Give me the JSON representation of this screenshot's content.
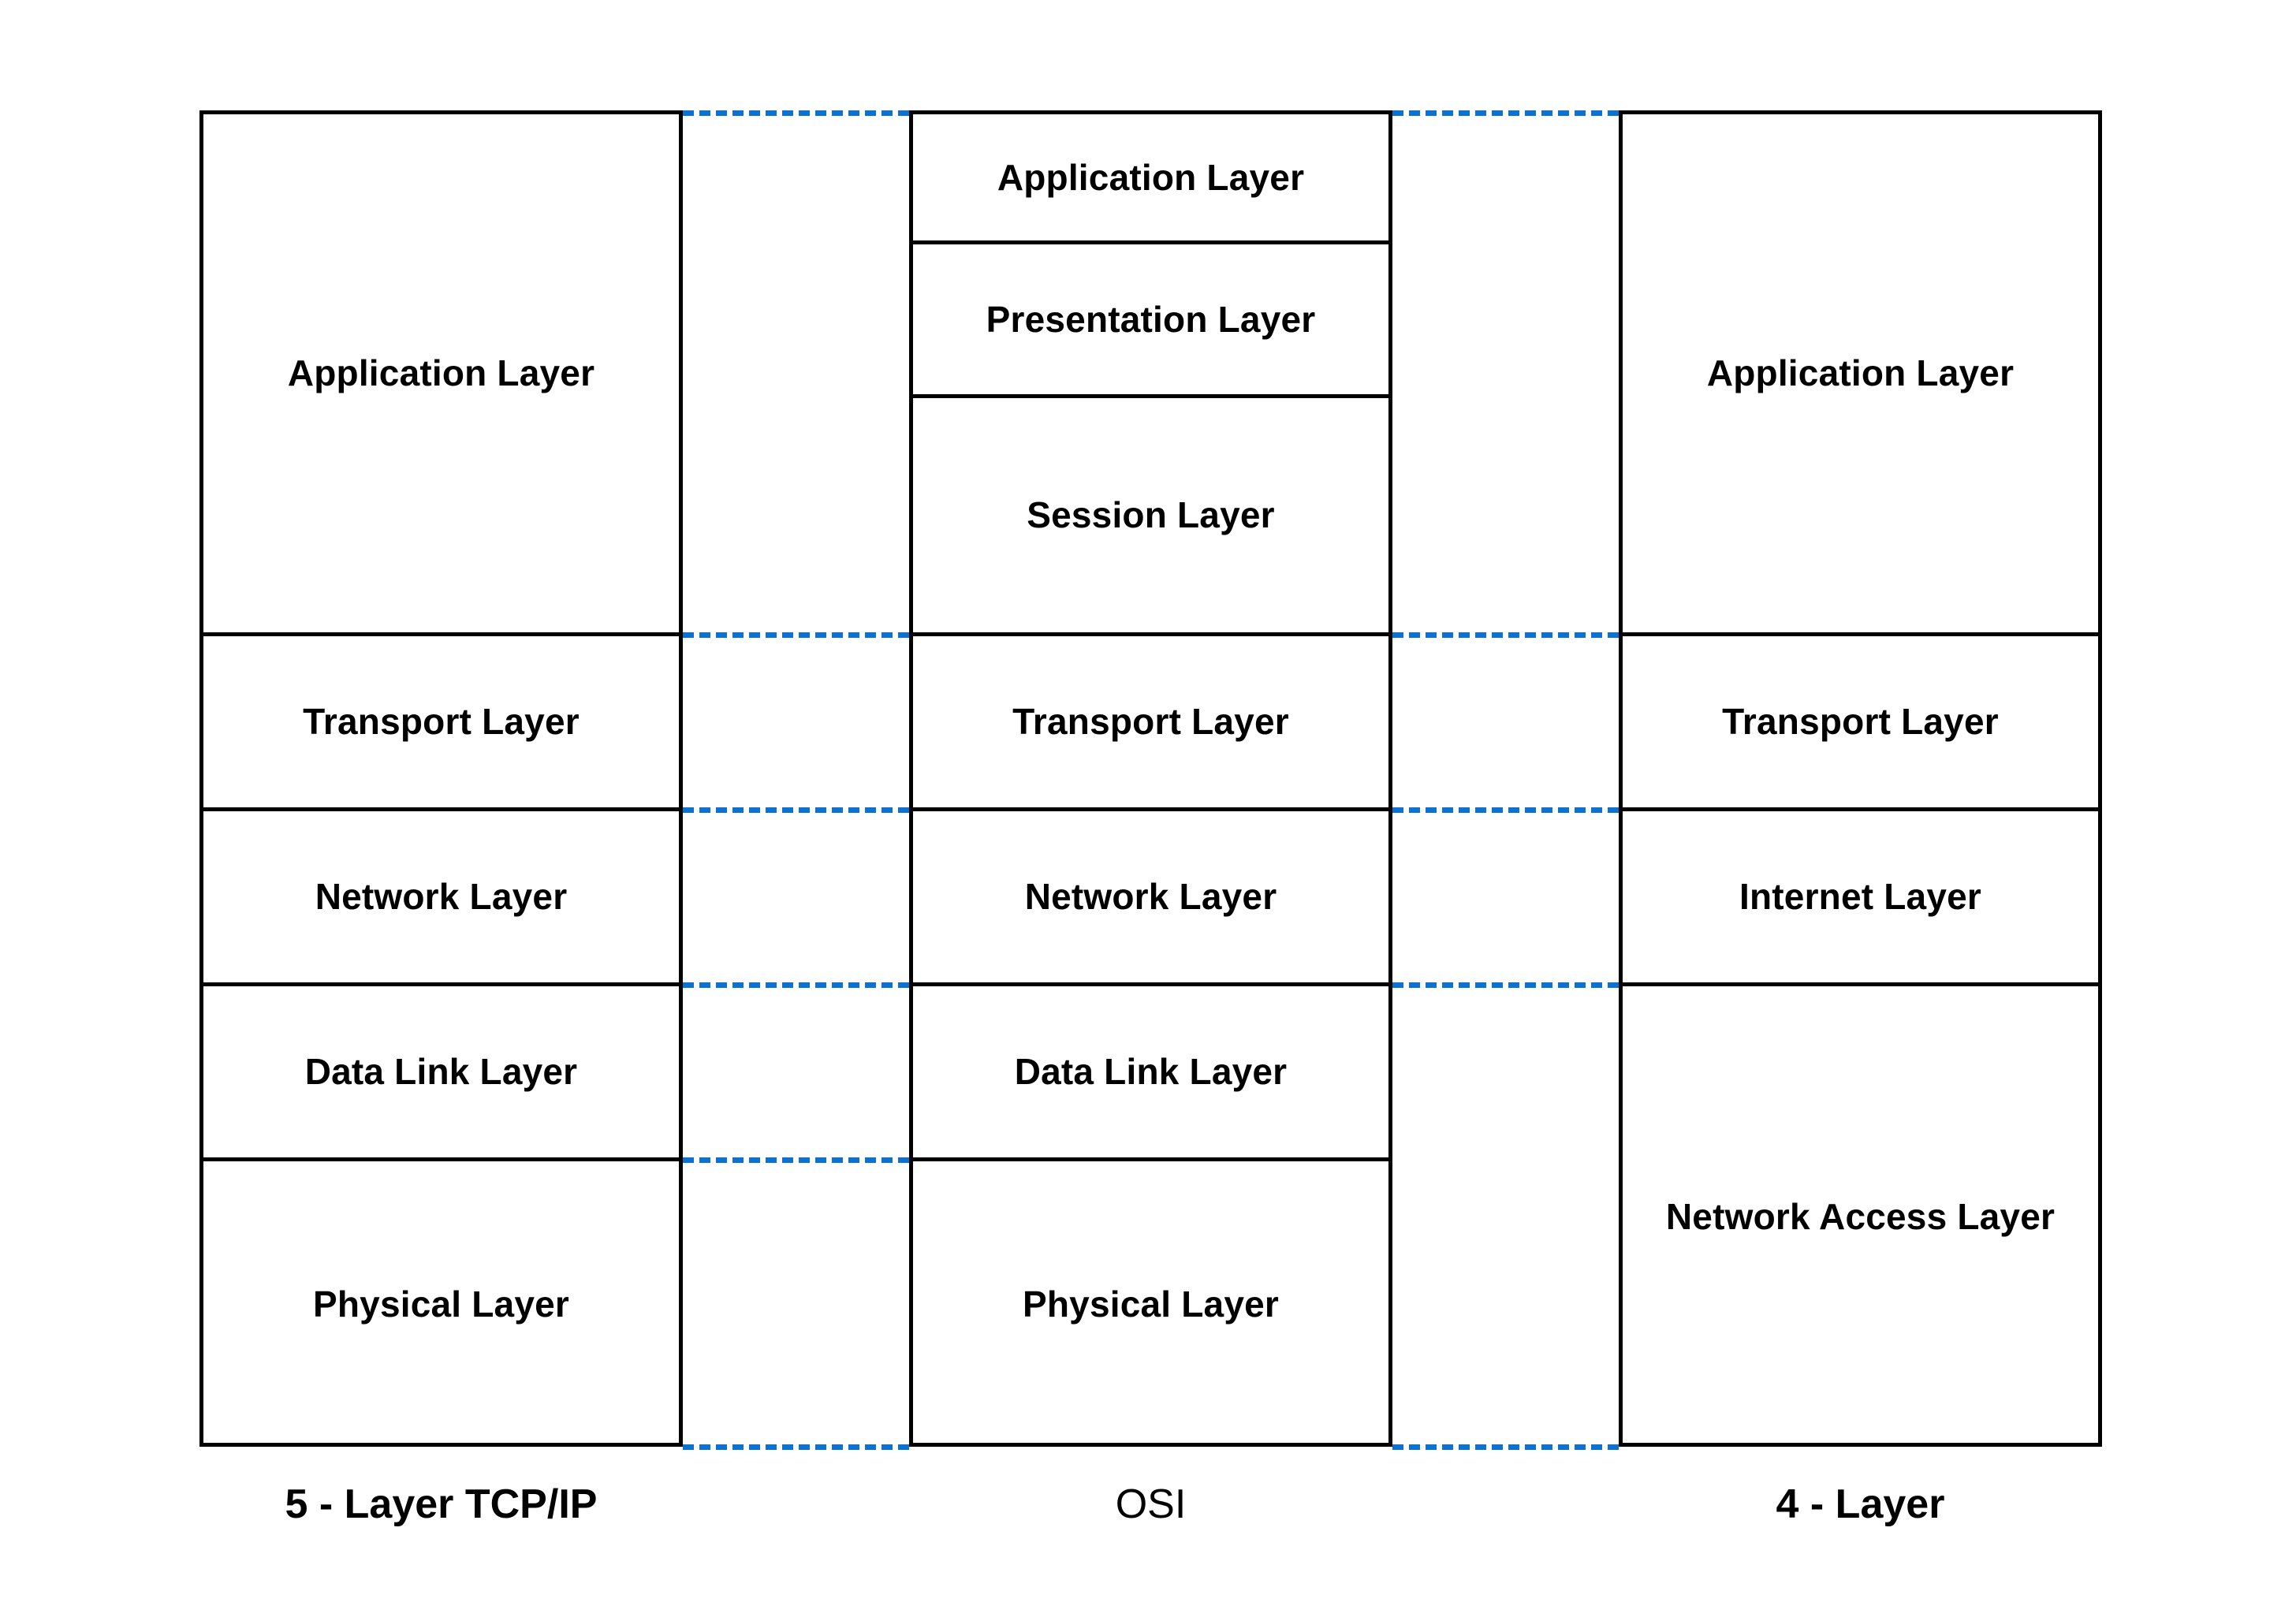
{
  "diagram": {
    "title_present": false,
    "accent_color": "#0d72cf",
    "line_color": "#000000",
    "background_color": "#ffffff",
    "columns": [
      {
        "id": "tcpip5",
        "caption": "5 - Layer TCP/IP",
        "layers": [
          "Application Layer",
          "Transport Layer",
          "Network Layer",
          "Data Link Layer",
          "Physical Layer"
        ]
      },
      {
        "id": "osi",
        "caption": "OSI",
        "layers": [
          "Application Layer",
          "Presentation Layer",
          "Session Layer",
          "Transport Layer",
          "Network Layer",
          "Data Link Layer",
          "Physical Layer"
        ]
      },
      {
        "id": "tcpip4",
        "caption": "4 - Layer",
        "layers": [
          "Application Layer",
          "Transport Layer",
          "Internet Layer",
          "Network Access Layer"
        ]
      }
    ],
    "connectors": {
      "left_gap_dash_count": 6,
      "right_gap_dash_count": 5,
      "style": "dashed",
      "color": "#0d72cf"
    }
  }
}
